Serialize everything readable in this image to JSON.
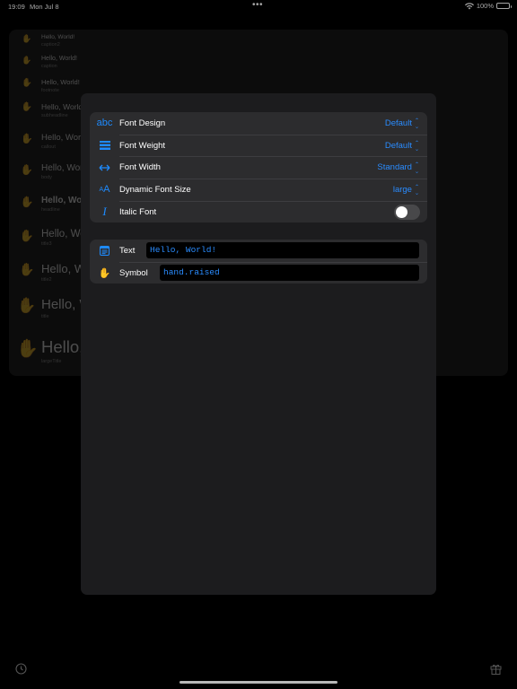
{
  "status_bar": {
    "time": "19:09",
    "date": "Mon Jul 8",
    "battery": "100%"
  },
  "samples": [
    {
      "text": "Hello, World!",
      "style": "caption2"
    },
    {
      "text": "Hello, World!",
      "style": "caption"
    },
    {
      "text": "Hello, World!",
      "style": "footnote"
    },
    {
      "text": "Hello, World",
      "style": "subheadline"
    },
    {
      "text": "Hello, World",
      "style": "callout"
    },
    {
      "text": "Hello, World",
      "style": "body"
    },
    {
      "text": "Hello, World",
      "style": "headline"
    },
    {
      "text": "Hello, World",
      "style": "title3"
    },
    {
      "text": "Hello, World",
      "style": "title2"
    },
    {
      "text": "Hello, World",
      "style": "title"
    },
    {
      "text": "Hello, World",
      "style": "largeTitle"
    }
  ],
  "settings": {
    "font_design": {
      "label": "Font Design",
      "value": "Default",
      "icon": "abc-icon"
    },
    "font_weight": {
      "label": "Font Weight",
      "value": "Default",
      "icon": "weight-icon"
    },
    "font_width": {
      "label": "Font Width",
      "value": "Standard",
      "icon": "width-arrows-icon"
    },
    "dynamic_font_size": {
      "label": "Dynamic Font Size",
      "value": "large",
      "icon": "textformat-size-icon"
    },
    "italic_font": {
      "label": "Italic Font",
      "on": false,
      "icon": "italic-icon"
    }
  },
  "inputs": {
    "text": {
      "label": "Text",
      "value": "Hello, World!",
      "icon": "text-window-icon"
    },
    "symbol": {
      "label": "Symbol",
      "value": "hand.raised",
      "icon": "hand-raised-icon"
    }
  },
  "colors": {
    "accent": "#1e8bff",
    "panel": "#1c1c1e",
    "group": "#2c2c2e"
  }
}
